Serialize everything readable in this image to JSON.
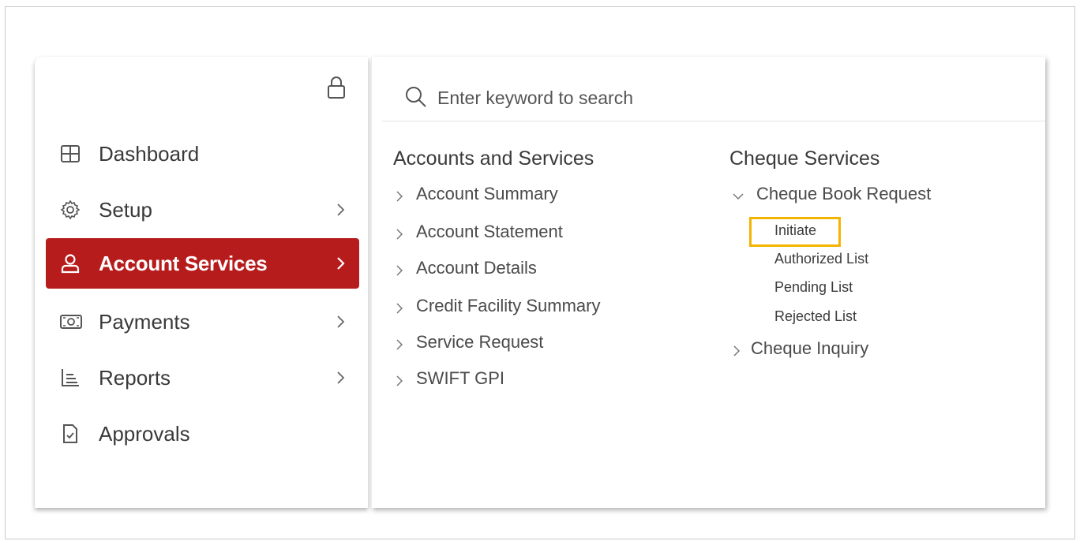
{
  "sidebar": {
    "items": [
      {
        "label": "Dashboard",
        "icon": "dashboard-grid-icon",
        "has_chevron": false
      },
      {
        "label": "Setup",
        "icon": "gear-icon",
        "has_chevron": true
      },
      {
        "label": "Account Services",
        "icon": "user-icon",
        "has_chevron": true,
        "active": true
      },
      {
        "label": "Payments",
        "icon": "cash-icon",
        "has_chevron": true
      },
      {
        "label": "Reports",
        "icon": "reports-icon",
        "has_chevron": true
      },
      {
        "label": "Approvals",
        "icon": "approval-document-icon",
        "has_chevron": false
      }
    ],
    "lock_icon": "lock-icon"
  },
  "search": {
    "placeholder": "Enter keyword to search"
  },
  "accounts": {
    "title": "Accounts and Services",
    "links": [
      "Account Summary",
      "Account Statement",
      "Account Details",
      "Credit Facility Summary",
      "Service Request",
      "SWIFT GPI"
    ]
  },
  "cheque": {
    "title": "Cheque Services",
    "book_request": "Cheque Book Request",
    "sub_items": [
      "Initiate",
      "Authorized List",
      "Pending List",
      "Rejected List"
    ],
    "inquiry": "Cheque Inquiry"
  },
  "colors": {
    "accent": "#b71c1c",
    "highlight": "#f2b400"
  }
}
